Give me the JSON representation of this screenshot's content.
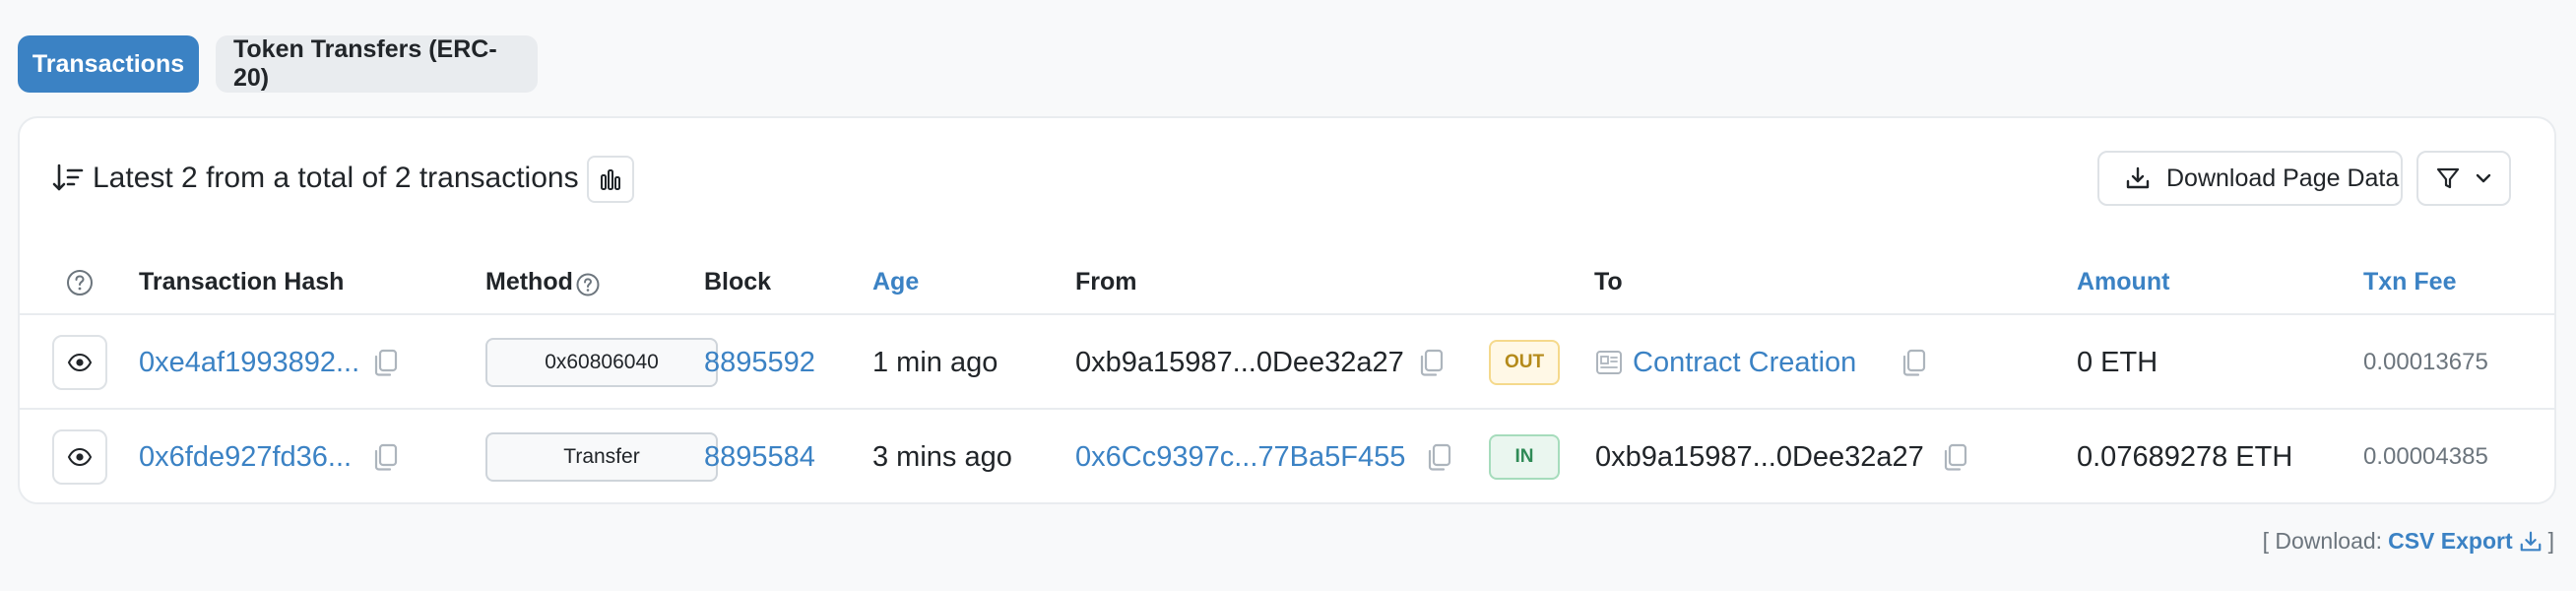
{
  "tabs": [
    {
      "label": "Transactions",
      "active": true
    },
    {
      "label": "Token Transfers (ERC-20)",
      "active": false
    }
  ],
  "summary": "Latest 2 from a total of 2 transactions",
  "download_button": "Download Page Data",
  "columns": {
    "hash": "Transaction Hash",
    "method": "Method",
    "block": "Block",
    "age": "Age",
    "from": "From",
    "to": "To",
    "amount": "Amount",
    "fee": "Txn Fee"
  },
  "rows": [
    {
      "hash": "0xe4af1993892...",
      "method": "0x60806040",
      "block": "8895592",
      "age": "1 min ago",
      "from": "0xb9a15987...0Dee32a27",
      "direction": "OUT",
      "to": "Contract Creation",
      "amount": "0 ETH",
      "fee": "0.00013675"
    },
    {
      "hash": "0x6fde927fd36...",
      "method": "Transfer",
      "block": "8895584",
      "age": "3 mins ago",
      "from": "0x6Cc9397c...77Ba5F455",
      "direction": "IN",
      "to": "0xb9a15987...0Dee32a27",
      "amount": "0.07689278 ETH",
      "fee": "0.00004385"
    }
  ],
  "footer": {
    "prefix": "[ Download:",
    "link": "CSV Export",
    "suffix": "]"
  },
  "colors": {
    "accent": "#3b82c4",
    "out_badge": "#b48a1a",
    "in_badge": "#2f8a56"
  }
}
